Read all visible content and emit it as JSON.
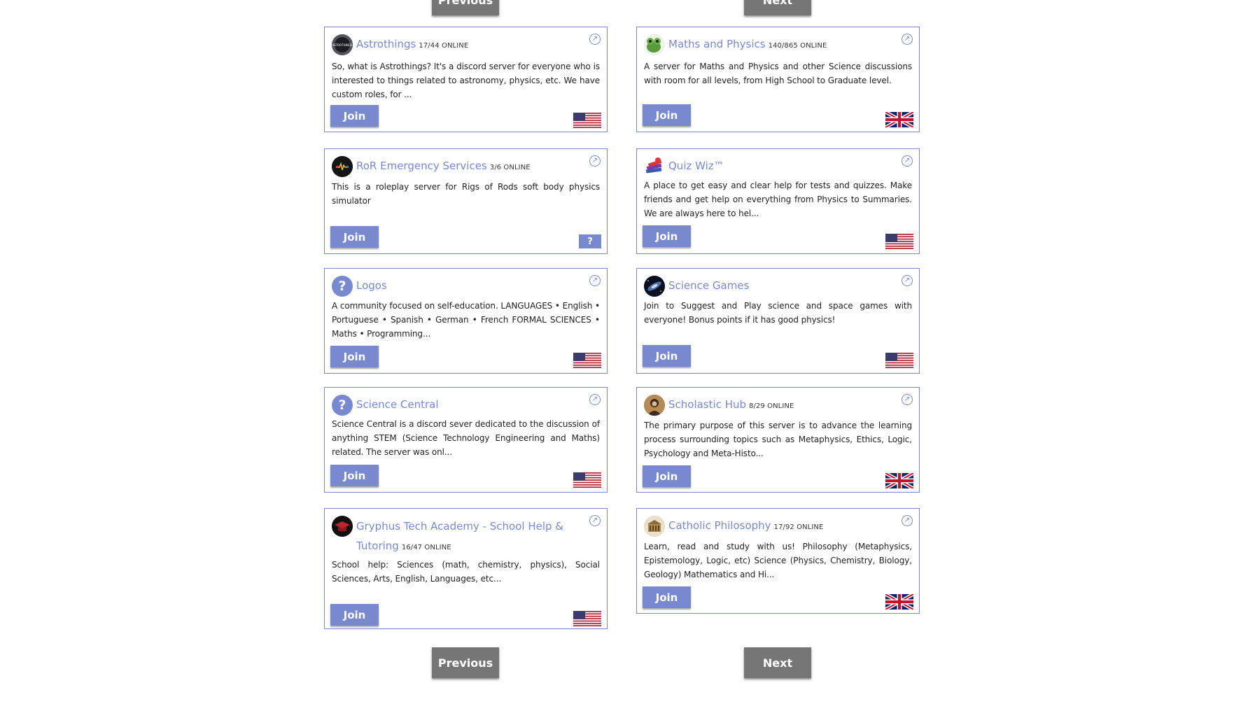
{
  "pagination": {
    "previous_label": "Previous",
    "next_label": "Next"
  },
  "cards": [
    {
      "name": "Astrothings",
      "online": "17/44 ONLINE",
      "description": "So, what is Astrothings? It's a discord server for everyone who is interested to things related to astronomy, physics, etc. We have custom roles, for ...",
      "join": "Join",
      "flag": "us",
      "avatar": "astrothings-logo",
      "avatar_text": "ASTROTHINGS"
    },
    {
      "name": "Maths and Physics",
      "online": "140/865 ONLINE",
      "description": "A server for Maths and Physics and other Science discussions with room for all levels, from High School to Graduate level.",
      "join": "Join",
      "flag": "gb",
      "avatar": "frog-avatar"
    },
    {
      "name": "RoR Emergency Services",
      "online": "3/6 ONLINE",
      "description": "This is a roleplay server for Rigs of Rods soft body physics simulator",
      "join": "Join",
      "flag": "unknown",
      "flag_text": "?",
      "avatar": "siren-avatar"
    },
    {
      "name": "Quiz Wiz™",
      "online": "",
      "description": "A place to get easy and clear help for tests and quizzes. Make friends and get help on everything from Physics to Summaries. We are always here to hel...",
      "join": "Join",
      "flag": "us",
      "avatar": "books-avatar"
    },
    {
      "name": "Logos",
      "online": "",
      "description": "A community focused on self-education. LANGUAGES • English • Portuguese • Spanish • German • French FORMAL SCIENCES • Maths • Programming...",
      "join": "Join",
      "flag": "us",
      "avatar": "question-avatar",
      "avatar_text": "?"
    },
    {
      "name": "Science Games",
      "online": "",
      "description": "Join to Suggest and Play science and space games with everyone! Bonus points if it has good physics!",
      "join": "Join",
      "flag": "us",
      "avatar": "galaxy-avatar"
    },
    {
      "name": "Science Central",
      "online": "",
      "description": "Science Central is a discord sever dedicated to the discussion of anything STEM (Science Technology Engineering and Maths) related. The server was onl...",
      "join": "Join",
      "flag": "us",
      "avatar": "question-avatar",
      "avatar_text": "?"
    },
    {
      "name": "Scholastic Hub",
      "online": "8/29 ONLINE",
      "description": "The primary purpose of this server is to advance the learning process surrounding topics such as Metaphysics, Ethics, Logic, Psychology and Meta-Histo...",
      "join": "Join",
      "flag": "gb",
      "avatar": "portrait-avatar"
    },
    {
      "name": "Gryphus Tech Academy - School Help & Tutoring",
      "online": "16/47 ONLINE",
      "description": "School help: Sciences (math, chemistry, physics), Social Sciences, Arts, English, Languages, etc...",
      "join": "Join",
      "flag": "us",
      "avatar": "graduation-cap-avatar"
    },
    {
      "name": "Catholic Philosophy",
      "online": "17/92 ONLINE",
      "description": "Learn, read and study with us! Philosophy (Metaphysics, Epistemology, Logic, etc) Science (Physics, Chemistry, Biology, Geology) Mathematics and Hi...",
      "join": "Join",
      "flag": "gb",
      "avatar": "building-avatar"
    }
  ]
}
